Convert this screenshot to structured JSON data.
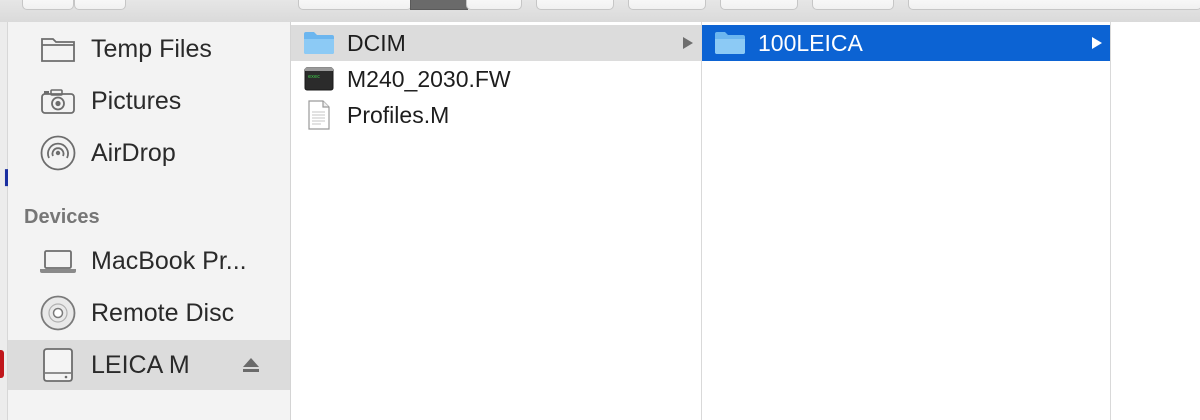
{
  "sidebar": {
    "favorites": [
      {
        "label": "Temp Files",
        "icon": "folder-icon"
      },
      {
        "label": "Pictures",
        "icon": "camera-icon"
      },
      {
        "label": "AirDrop",
        "icon": "airdrop-icon"
      }
    ],
    "devices_header": "Devices",
    "devices": [
      {
        "label": "MacBook Pr...",
        "icon": "laptop-icon"
      },
      {
        "label": "Remote Disc",
        "icon": "disc-icon"
      },
      {
        "label": "LEICA M",
        "icon": "drive-icon",
        "selected": true,
        "ejectable": true
      }
    ]
  },
  "columns": {
    "col1": [
      {
        "name": "DCIM",
        "icon": "folder-icon",
        "has_children": true,
        "state": "parent-selected"
      },
      {
        "name": "M240_2030.FW",
        "icon": "terminal-file-icon",
        "has_children": false
      },
      {
        "name": "Profiles.M",
        "icon": "document-icon",
        "has_children": false
      }
    ],
    "col2": [
      {
        "name": "100LEICA",
        "icon": "folder-icon",
        "has_children": true,
        "state": "selected"
      }
    ]
  },
  "colors": {
    "selection_blue": "#0c63d3",
    "sidebar_bg": "#f3f3f3",
    "folder_blue": "#6cb6ef"
  }
}
